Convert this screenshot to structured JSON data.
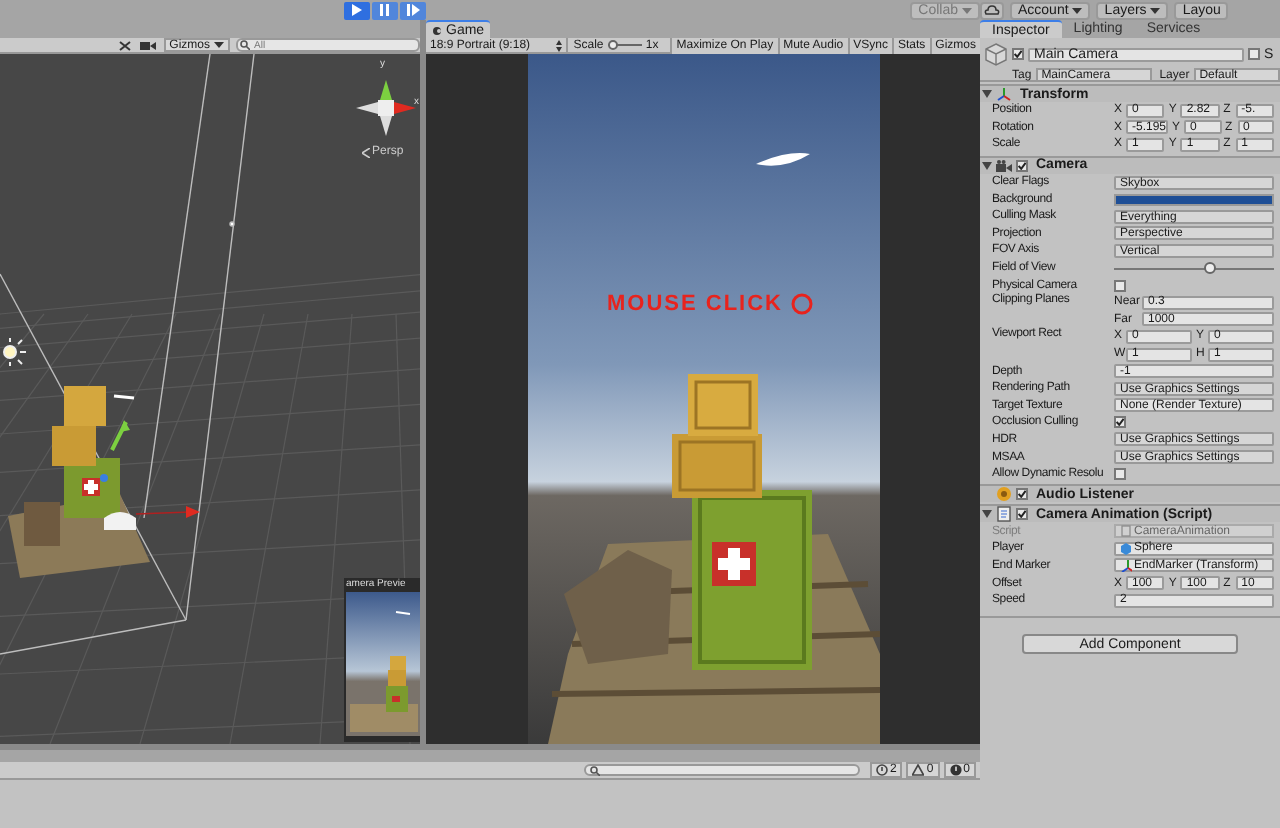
{
  "toolbar": {
    "play_buttons": [
      {
        "kind": "play",
        "selected": true
      },
      {
        "kind": "pause",
        "selected": false
      },
      {
        "kind": "step",
        "selected": false
      }
    ],
    "collab": "Collab",
    "account": "Account",
    "layers": "Layers",
    "layout": "Layou"
  },
  "scene": {
    "gizmos": "Gizmos",
    "search_placeholder": "All",
    "axis_labels": [
      "y",
      "x"
    ],
    "view_label": "Persp",
    "preview_title": "amera Previe"
  },
  "game": {
    "tab": "Game",
    "aspect": "18:9 Portrait (9:18)",
    "scale_label": "Scale",
    "scale_slider": {
      "level": 0.05
    },
    "scale_value": "1x",
    "toggles": [
      {
        "label": "Maximize On Play",
        "on": false
      },
      {
        "label": "Mute Audio",
        "on": false
      },
      {
        "label": "VSync",
        "on": false
      },
      {
        "label": "Stats",
        "on": false
      },
      {
        "label": "Gizmos",
        "on": false
      }
    ],
    "overlay_text": "MOUSE CLICK"
  },
  "inspector": {
    "tabs": [
      {
        "label": "Inspector",
        "selected": true
      },
      {
        "label": "Lighting",
        "selected": false
      },
      {
        "label": "Services",
        "selected": false
      }
    ],
    "object": {
      "active": true,
      "name": "Main Camera",
      "static_checked": false,
      "static_label": "S",
      "tag_label": "Tag",
      "tag": "MainCamera",
      "layer_label": "Layer",
      "layer": "Default"
    },
    "components": [
      {
        "title": "Transform",
        "expanded": true,
        "rows": [
          {
            "kind": "vector",
            "label": "Position",
            "axes": [
              {
                "axis": "X",
                "value": "0"
              },
              {
                "axis": "Y",
                "value": "2.82"
              },
              {
                "axis": "Z",
                "value": "-5."
              }
            ]
          },
          {
            "kind": "vector",
            "label": "Rotation",
            "axes": [
              {
                "axis": "X",
                "value": "-5.195"
              },
              {
                "axis": "Y",
                "value": "0"
              },
              {
                "axis": "Z",
                "value": "0"
              }
            ]
          },
          {
            "kind": "vector",
            "label": "Scale",
            "axes": [
              {
                "axis": "X",
                "value": "1"
              },
              {
                "axis": "Y",
                "value": "1"
              },
              {
                "axis": "Z",
                "value": "1"
              }
            ]
          }
        ]
      },
      {
        "title": "Camera",
        "expanded": true,
        "enabled": true,
        "rows": [
          {
            "kind": "dropdown",
            "label": "Clear Flags",
            "value": "Skybox"
          },
          {
            "kind": "color",
            "label": "Background",
            "color": "#1f4f96"
          },
          {
            "kind": "dropdown",
            "label": "Culling Mask",
            "value": "Everything"
          },
          {
            "kind": "dropdown",
            "label": "Projection",
            "value": "Perspective"
          },
          {
            "kind": "dropdown",
            "label": "FOV Axis",
            "value": "Vertical"
          },
          {
            "kind": "slider",
            "label": "Field of View",
            "level": 0.6
          },
          {
            "kind": "check",
            "label": "Physical Camera",
            "checked": false
          },
          {
            "kind": "pair",
            "label": "Clipping Planes",
            "fields": [
              {
                "axis": "Near",
                "value": "0.3"
              },
              {
                "axis": "Far",
                "value": "1000"
              }
            ]
          },
          {
            "kind": "rect",
            "label": "Viewport Rect",
            "lines": [
              [
                {
                  "axis": "X",
                  "value": "0"
                },
                {
                  "axis": "Y",
                  "value": "0"
                }
              ],
              [
                {
                  "axis": "W",
                  "value": "1"
                },
                {
                  "axis": "H",
                  "value": "1"
                }
              ]
            ]
          },
          {
            "kind": "text",
            "label": "Depth",
            "value": "-1"
          },
          {
            "kind": "dropdown",
            "label": "Rendering Path",
            "value": "Use Graphics Settings"
          },
          {
            "kind": "object",
            "label": "Target Texture",
            "value": "None (Render Texture)"
          },
          {
            "kind": "check",
            "label": "Occlusion Culling",
            "checked": true
          },
          {
            "kind": "dropdown",
            "label": "HDR",
            "value": "Use Graphics Settings"
          },
          {
            "kind": "dropdown",
            "label": "MSAA",
            "value": "Use Graphics Settings"
          },
          {
            "kind": "check",
            "label": "Allow Dynamic Resolu",
            "checked": false
          }
        ]
      },
      {
        "title": "Audio Listener",
        "expanded": false,
        "enabled": true
      },
      {
        "title": "Camera Animation (Script)",
        "expanded": true,
        "enabled": true,
        "rows": [
          {
            "kind": "script",
            "label": "Script",
            "value": "CameraAnimation",
            "disabled": true
          },
          {
            "kind": "object",
            "label": "Player",
            "value": "Sphere"
          },
          {
            "kind": "object",
            "label": "End Marker",
            "value": "EndMarker (Transform)"
          },
          {
            "kind": "vector",
            "label": "Offset",
            "axes": [
              {
                "axis": "X",
                "value": "100"
              },
              {
                "axis": "Y",
                "value": "100"
              },
              {
                "axis": "Z",
                "value": "10"
              }
            ]
          },
          {
            "kind": "text",
            "label": "Speed",
            "value": "2"
          }
        ]
      }
    ],
    "add_button": "Add Component"
  },
  "console": {
    "counts": [
      {
        "kind": "info",
        "count": "2"
      },
      {
        "kind": "warning",
        "count": "0"
      },
      {
        "kind": "error",
        "count": "0"
      }
    ]
  }
}
